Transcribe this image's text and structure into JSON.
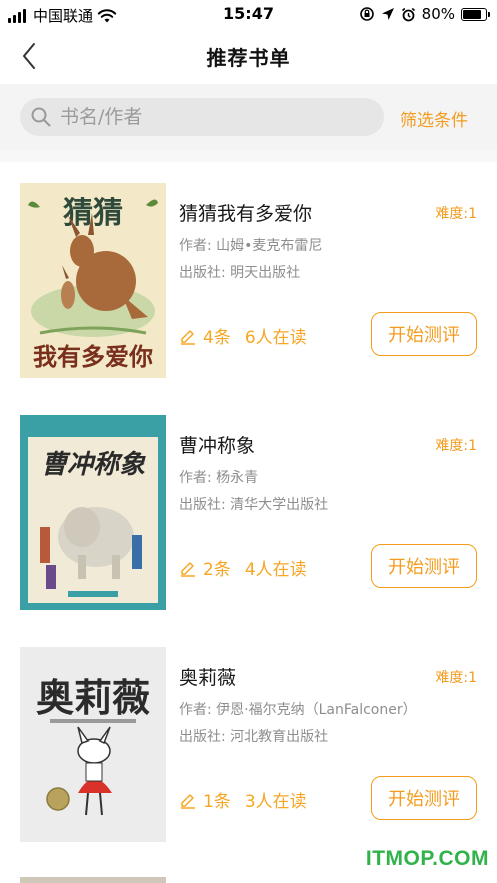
{
  "status_bar": {
    "carrier": "中国联通",
    "time": "15:47",
    "battery": "80%",
    "battery_level": 0.8
  },
  "nav": {
    "title": "推荐书单"
  },
  "search": {
    "placeholder": "书名/作者",
    "filter_label": "筛选条件"
  },
  "books": [
    {
      "title": "猜猜我有多爱你",
      "difficulty": "难度:1",
      "author": "作者: 山姆•麦克布雷尼",
      "publisher": "出版社: 明天出版社",
      "reviews": "4条",
      "readers": "6人在读",
      "action": "开始测评",
      "cover_title_top": "猜猜",
      "cover_title_bottom": "我有多爱你",
      "cover_bg": "#f3e9c8"
    },
    {
      "title": "曹冲称象",
      "difficulty": "难度:1",
      "author": "作者: 杨永青",
      "publisher": "出版社: 清华大学出版社",
      "reviews": "2条",
      "readers": "4人在读",
      "action": "开始测评",
      "cover_title": "曹冲称象",
      "cover_bg": "#3aa0a6"
    },
    {
      "title": "奥莉薇",
      "difficulty": "难度:1",
      "author": "作者: 伊恩·福尔克纳（LanFalconer）",
      "publisher": "出版社: 河北教育出版社",
      "reviews": "1条",
      "readers": "3人在读",
      "action": "开始测评",
      "cover_title": "奥莉薇",
      "cover_bg": "#ececec"
    }
  ],
  "watermark": "ITMOP.COM",
  "colors": {
    "accent": "#f39c1e",
    "watermark": "#2fb34a"
  }
}
